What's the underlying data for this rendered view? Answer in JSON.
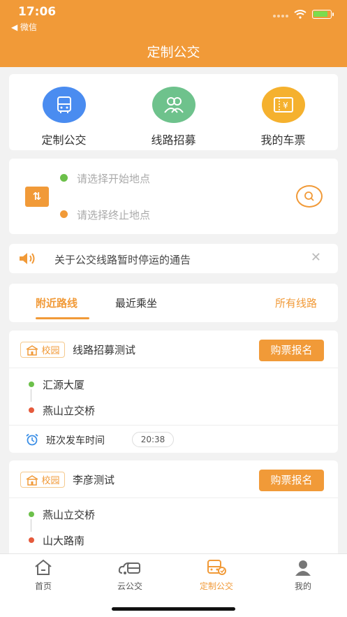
{
  "status_bar": {
    "time": "17:06",
    "back_label": "◀ 微信"
  },
  "header": {
    "title": "定制公交"
  },
  "quick_actions": [
    {
      "label": "定制公交",
      "icon": "bus-icon"
    },
    {
      "label": "线路招募",
      "icon": "people-icon"
    },
    {
      "label": "我的车票",
      "icon": "ticket-icon"
    }
  ],
  "route_search": {
    "start_placeholder": "请选择开始地点",
    "end_placeholder": "请选择终止地点"
  },
  "notice": {
    "text": "关于公交线路暂时停运的通告",
    "close": "✕"
  },
  "tabs": {
    "nearby": "附近路线",
    "recent": "最近乘坐",
    "all": "所有线路"
  },
  "lines": [
    {
      "badge": "校园",
      "title": "线路招募测试",
      "button": "购票报名",
      "stops": [
        "汇源大厦",
        "燕山立交桥"
      ],
      "schedule_label": "班次发车时间",
      "departure_time": "20:38"
    },
    {
      "badge": "校园",
      "title": "李彦测试",
      "button": "购票报名",
      "stops": [
        "燕山立交桥",
        "山大路南"
      ]
    }
  ],
  "tabbar": [
    {
      "label": "首页",
      "icon": "home-icon"
    },
    {
      "label": "云公交",
      "icon": "cloud-bus-icon"
    },
    {
      "label": "定制公交",
      "icon": "custom-bus-icon",
      "active": true
    },
    {
      "label": "我的",
      "icon": "profile-icon"
    }
  ],
  "colors": {
    "accent": "#f19a38",
    "green_dot": "#6cc04a",
    "red_dot": "#e55a3c"
  }
}
